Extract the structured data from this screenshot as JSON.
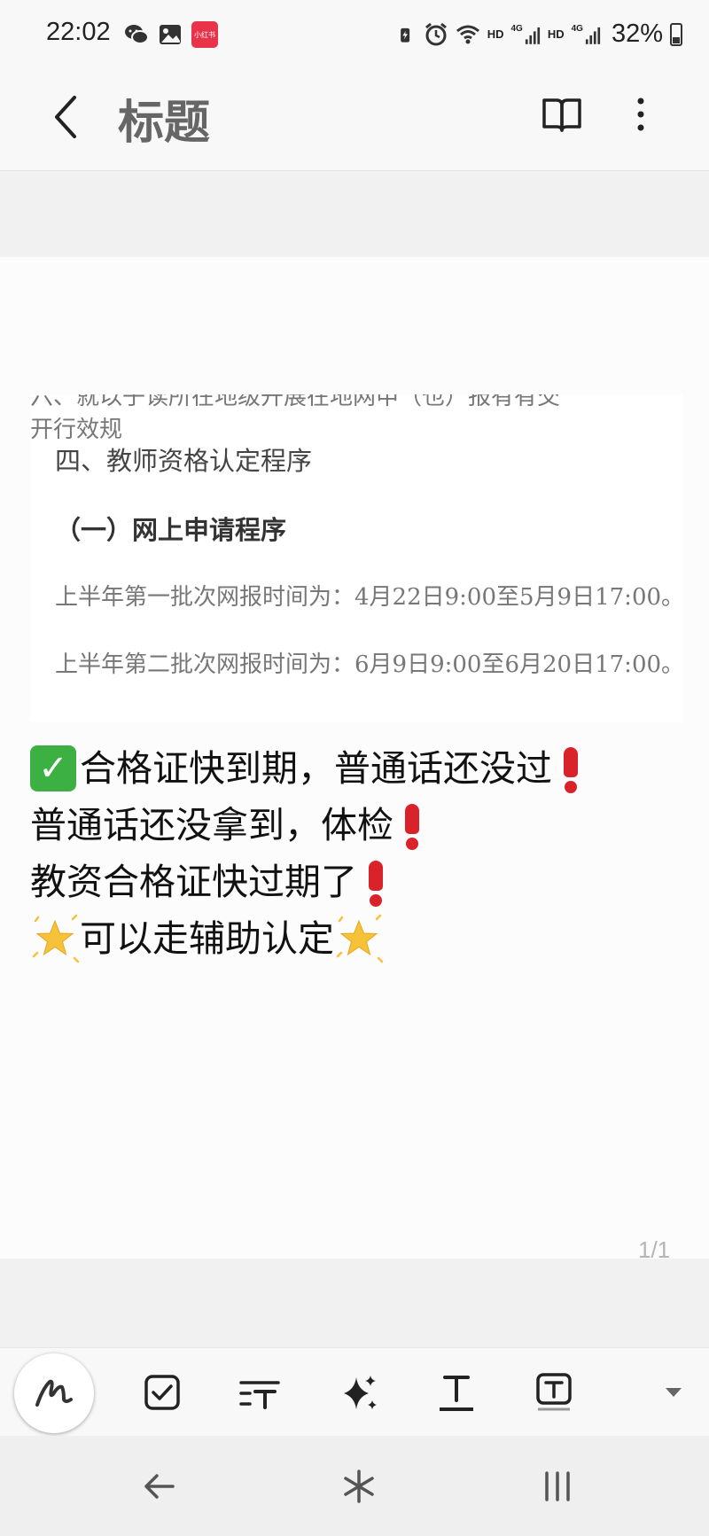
{
  "status_bar": {
    "time": "22:02",
    "app_badge": "小红书",
    "net1": "HD",
    "net1_type": "4G",
    "net2": "HD",
    "net2_type": "4G",
    "battery_percent": "32%",
    "battery_level": 0.32
  },
  "app_bar": {
    "title": "标题",
    "icons": [
      "back-arrow-icon",
      "open-book-icon",
      "more-vertical-icon"
    ]
  },
  "document_image": {
    "cut_top_text": "六、就以子读所在地级开展在地网申（也）报有有交开行效规",
    "heading": "四、教师资格认定程序",
    "subheading": "（一）网上申请程序",
    "para1": "上半年第一批次网报时间为：4月22日9:00至5月9日17:00。",
    "para2": "上半年第二批次网报时间为：6月9日9:00至6月20日17:00。"
  },
  "note": {
    "line1": "合格证快到期，普通话还没过",
    "line2": "普通话还没拿到，体检",
    "line3": "教资合格证快过期了",
    "line4": "可以走辅助认定"
  },
  "page_indicator": "1/1",
  "toolbar": {
    "tools": [
      "pen-tool",
      "checkbox-tool",
      "text-style-tool",
      "ai-sparkle-tool",
      "text-format-tool",
      "text-box-tool",
      "expand-toolbar"
    ]
  },
  "nav": {
    "buttons": [
      "nav-back",
      "nav-home",
      "nav-recents"
    ]
  }
}
